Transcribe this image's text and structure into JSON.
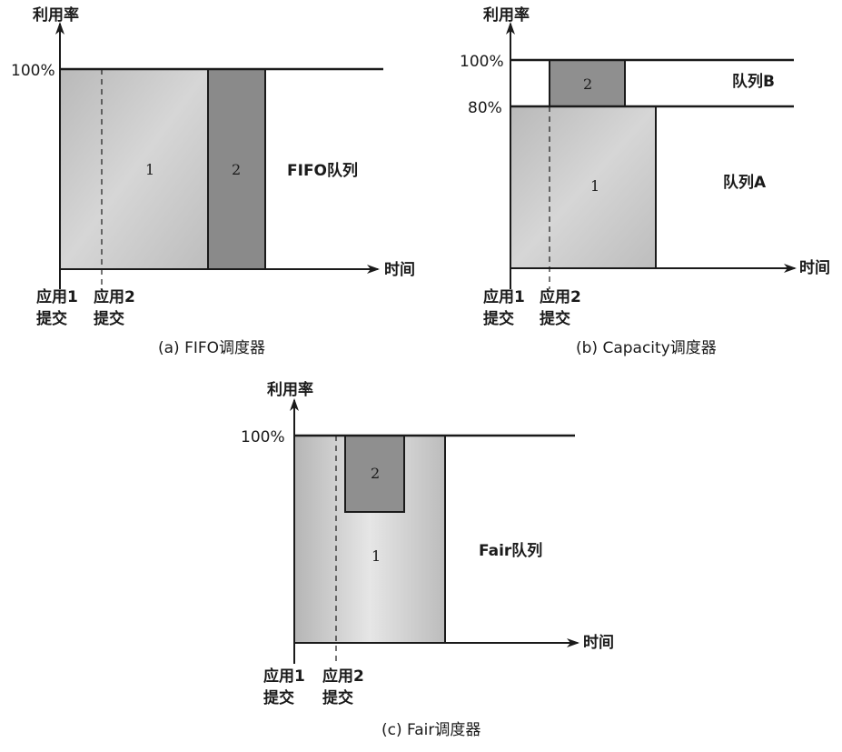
{
  "axis": {
    "y_label": "利用率",
    "x_label": "时间",
    "pct_100": "100%",
    "pct_80": "80%"
  },
  "events": {
    "app1_line1": "应用1",
    "app1_line2": "提交",
    "app2_line1": "应用2",
    "app2_line2": "提交"
  },
  "panels": {
    "fifo": {
      "caption": "(a) FIFO调度器",
      "queue_label": "FIFO队列",
      "job1": "1",
      "job2": "2"
    },
    "capacity": {
      "caption": "(b) Capacity调度器",
      "queue_b": "队列B",
      "queue_a": "队列A",
      "job1": "1",
      "job2": "2"
    },
    "fair": {
      "caption": "(c) Fair调度器",
      "queue_label": "Fair队列",
      "job1": "1",
      "job2": "2"
    }
  },
  "colors": {
    "job1_fill": "#c4c4c4",
    "job2_fill": "#8a8a8a",
    "line": "#1a1a1a"
  }
}
